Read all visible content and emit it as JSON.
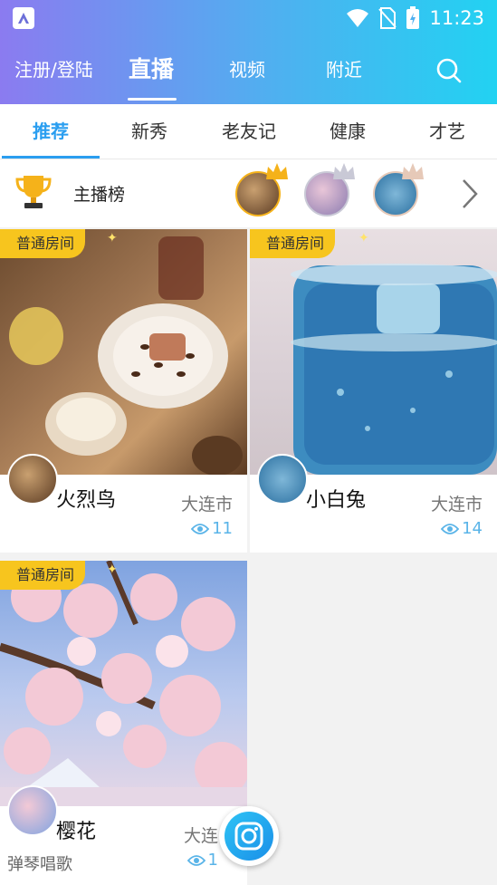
{
  "status_bar": {
    "time": "11:23"
  },
  "top_nav": {
    "login": "注册/登陆",
    "live": "直播",
    "video": "视频",
    "nearby": "附近"
  },
  "categories": [
    "推荐",
    "新秀",
    "老友记",
    "健康",
    "才艺"
  ],
  "ranking": {
    "label": "主播榜"
  },
  "rooms": [
    {
      "badge": "普通房间",
      "name": "火烈鸟",
      "city": "大连市",
      "views": "11",
      "subtitle": ""
    },
    {
      "badge": "普通房间",
      "name": "小白兔",
      "city": "大连市",
      "views": "14",
      "subtitle": ""
    },
    {
      "badge": "普通房间",
      "name": "樱花",
      "city": "大连",
      "views": "1",
      "subtitle": "弹琴唱歌"
    }
  ],
  "colors": {
    "accent": "#2a9ef0",
    "badge": "#f7c51e",
    "header_start": "#8b7bf0",
    "header_end": "#22d2f2"
  }
}
